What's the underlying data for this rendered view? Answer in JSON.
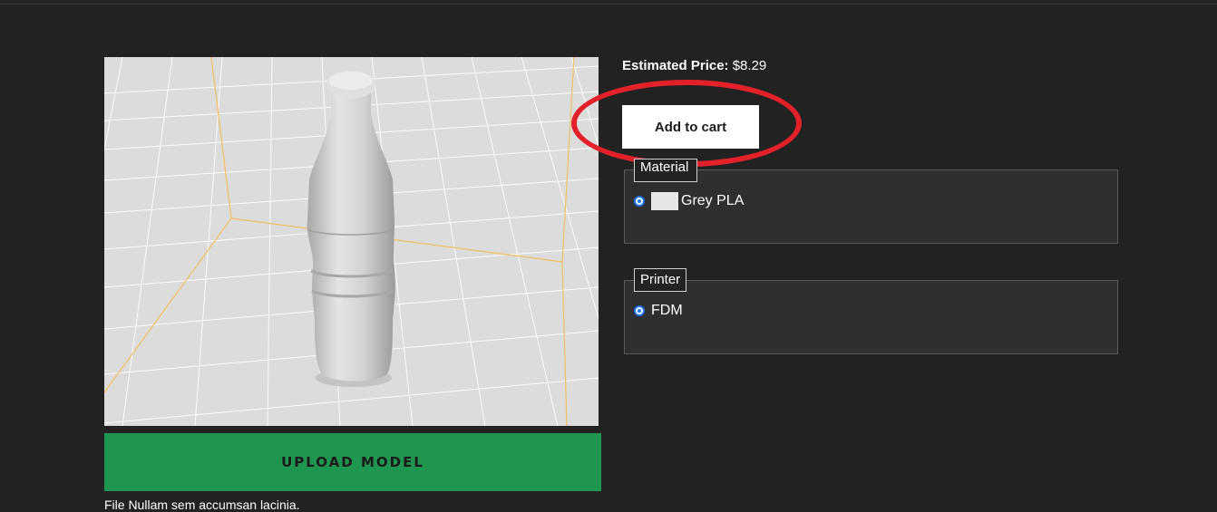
{
  "viewer": {
    "model_icon": "bottle-model",
    "background_color": "#dcdcdc",
    "grid_color": "#ffffff",
    "bounds_color": "#f0c060"
  },
  "upload": {
    "label": "UPLOAD MODEL",
    "note": "File Nullam sem accumsan lacinia."
  },
  "price": {
    "label": "Estimated Price:",
    "value": "$8.29"
  },
  "cart": {
    "label": "Add to cart",
    "highlight_color": "#e3212b"
  },
  "material": {
    "legend": "Material",
    "options": [
      {
        "label": "Grey PLA",
        "selected": true,
        "swatch_color": "#e6e6e6"
      }
    ]
  },
  "printer": {
    "legend": "Printer",
    "options": [
      {
        "label": "FDM",
        "selected": true
      }
    ]
  },
  "colors": {
    "page_background": "#222222",
    "upload_button": "#1e9650",
    "radio_accent": "#1a73e8"
  }
}
